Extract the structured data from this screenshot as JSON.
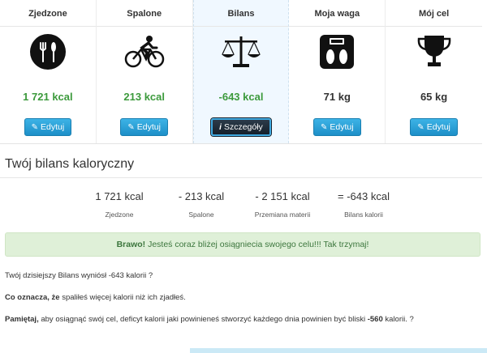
{
  "summary": [
    {
      "header": "Zjedzone",
      "icon": "cutlery-icon",
      "value": "1 721 kcal",
      "value_color": "green",
      "button": "Edytuj"
    },
    {
      "header": "Spalone",
      "icon": "bicycle-icon",
      "value": "213 kcal",
      "value_color": "green",
      "button": "Edytuj"
    },
    {
      "header": "Bilans",
      "icon": "balance-scale-icon",
      "value": "-643 kcal",
      "value_color": "green",
      "button": "Szczegóły"
    },
    {
      "header": "Moja waga",
      "icon": "weighing-scale-icon",
      "value": "71 kg",
      "value_color": "black",
      "button": "Edytuj"
    },
    {
      "header": "Mój cel",
      "icon": "trophy-icon",
      "value": "65 kg",
      "value_color": "black",
      "button": "Edytuj"
    }
  ],
  "section_title": "Twój bilans kaloryczny",
  "stats": [
    {
      "value": "1 721 kcal",
      "label": "Zjedzone"
    },
    {
      "value": "- 213 kcal",
      "label": "Spalone"
    },
    {
      "value": "- 2 151 kcal",
      "label": "Przemiana materii"
    },
    {
      "value": "= -643 kcal",
      "label": "Bilans kalorii"
    }
  ],
  "alert": {
    "strong": "Brawo!",
    "text": "Jesteś coraz bliżej osiągniecia swojego celu!!! Tak trzymaj!"
  },
  "info": {
    "line1": "Twój dzisiejszy Bilans wyniósł -643 kalorii ?",
    "line2_strong": "Co oznacza, że",
    "line2_text": "spaliłeś więcej kalorii niż ich zjadłeś.",
    "line3_strong": "Pamiętaj,",
    "line3_text": "aby osiągnąć swój cel, deficyt kalorii jaki powinieneś stworzyć każdego dnia powinien być bliski",
    "line3_value": "-560",
    "line3_end": "kalorii. ?"
  },
  "colors": {
    "green": "#3c9a3c",
    "button_blue": "#1d8fc8",
    "alert_bg": "#dff0d8",
    "alert_text": "#3c763d"
  }
}
